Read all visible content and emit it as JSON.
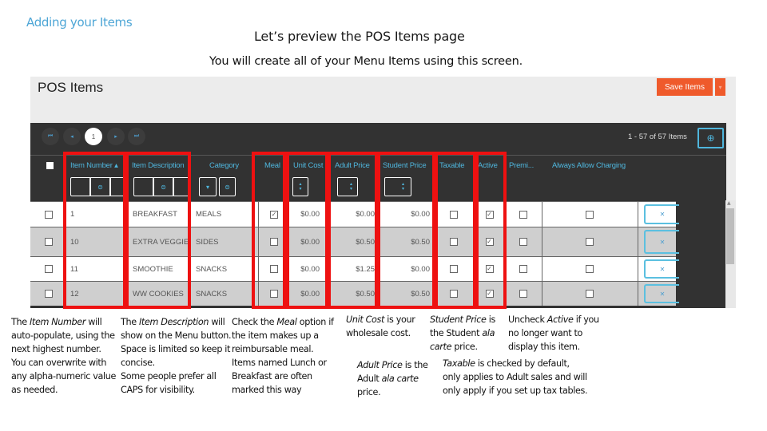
{
  "slide": {
    "header": "Adding your Items",
    "title": "Let’s preview the POS Items page",
    "subtitle": "You will create all of your Menu Items using this screen."
  },
  "app": {
    "title": "POS Items",
    "save_button": "Save Items",
    "more_button": "▾",
    "pager": {
      "first": "⏮",
      "prev": "◂",
      "current_page": "1",
      "next": "▸",
      "last": "⏭",
      "info": "1 - 57 of 57 Items"
    },
    "add_icon": "⊕",
    "columns": [
      {
        "key": "item_number",
        "label": "Item Number ▴"
      },
      {
        "key": "item_description",
        "label": "Item Description"
      },
      {
        "key": "category",
        "label": "Category"
      },
      {
        "key": "meal",
        "label": "Meal"
      },
      {
        "key": "unit_cost",
        "label": "Unit Cost"
      },
      {
        "key": "adult_price",
        "label": "Adult Price"
      },
      {
        "key": "student_price",
        "label": "Student Price"
      },
      {
        "key": "taxable",
        "label": "Taxable"
      },
      {
        "key": "active",
        "label": "Active"
      },
      {
        "key": "premium",
        "label": "Premi..."
      },
      {
        "key": "always_allow_charging",
        "label": "Always Allow Charging"
      }
    ],
    "filter_icon": "⊜",
    "dropdown_icon": "▾",
    "spin_up": "▴",
    "spin_down": "▾",
    "rows": [
      {
        "item_number": "1",
        "description": "BREAKFAST",
        "category": "MEALS",
        "meal": true,
        "unit_cost": "$0.00",
        "adult_price": "$0.00",
        "student_price": "$0.00",
        "taxable": false,
        "active": true,
        "premium": false,
        "always_allow_charging": false
      },
      {
        "item_number": "10",
        "description": "EXTRA VEGGIE",
        "category": "SIDES",
        "meal": false,
        "unit_cost": "$0.00",
        "adult_price": "$0.50",
        "student_price": "$0.50",
        "taxable": false,
        "active": true,
        "premium": false,
        "always_allow_charging": false
      },
      {
        "item_number": "11",
        "description": "SMOOTHIE",
        "category": "SNACKS",
        "meal": false,
        "unit_cost": "$0.00",
        "adult_price": "$1.25",
        "student_price": "$0.00",
        "taxable": false,
        "active": true,
        "premium": false,
        "always_allow_charging": false
      },
      {
        "item_number": "12",
        "description": "WW COOKIES",
        "category": "SNACKS",
        "meal": false,
        "unit_cost": "$0.00",
        "adult_price": "$0.50",
        "student_price": "$0.50",
        "taxable": false,
        "active": true,
        "premium": false,
        "always_allow_charging": false
      }
    ],
    "delete_icon": "✕",
    "check_mark": "✓"
  },
  "notes": {
    "item_number": {
      "pre": "The ",
      "em": "Item Number",
      "post": " will auto-populate, using the next highest number.",
      "extra": "You can overwrite with any alpha-numeric value as needed."
    },
    "item_description": {
      "pre": "The ",
      "em": "Item Description",
      "post": " will show on the Menu button. Space is limited so keep it concise.",
      "extra": "Some people prefer all CAPS for visibility."
    },
    "meal": {
      "pre": "Check the ",
      "em": "Meal",
      "post": " option if the item makes up a reimbursable meal.",
      "extra": "Items named Lunch or Breakfast are often marked this way"
    },
    "unit_cost": {
      "em": "Unit Cost",
      "post": " is your wholesale cost."
    },
    "adult_price": {
      "em": "Adult Price",
      "mid": " is the Adult ",
      "em2": "ala carte",
      "post": " price."
    },
    "student_price": {
      "em": "Student Price",
      "mid": " is the Student ",
      "em2": "ala carte",
      "post": " price."
    },
    "active": {
      "pre": "Uncheck ",
      "em": "Active",
      "post": " if you no longer want to display this item."
    },
    "taxable": {
      "em": "Taxable",
      "post": " is checked by default, only applies to Adult sales and will only apply if you set up tax tables."
    }
  }
}
